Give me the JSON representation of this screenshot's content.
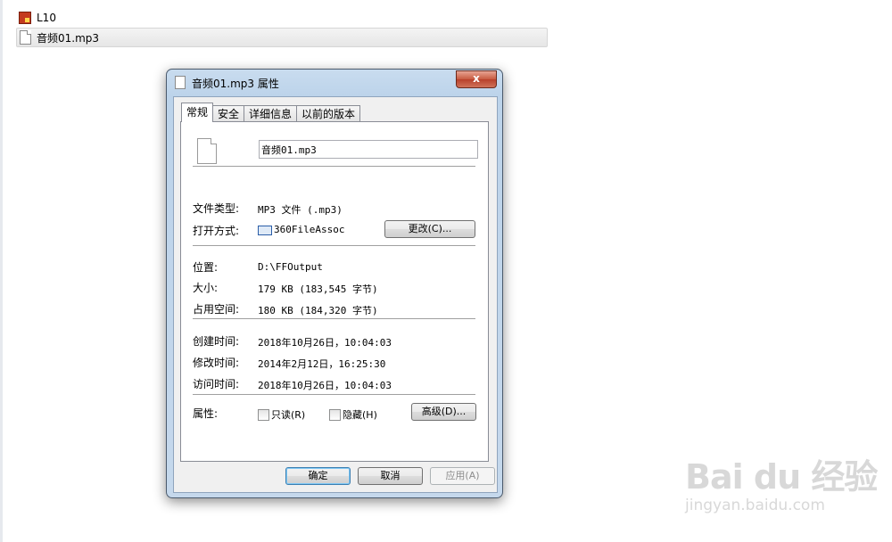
{
  "file_list": [
    {
      "name": "L10",
      "icon": "library-icon"
    },
    {
      "name": "音频01.mp3",
      "icon": "document-icon",
      "selected": true
    }
  ],
  "dialog": {
    "title": "音频01.mp3 属性",
    "close_label": "x",
    "tabs": [
      "常规",
      "安全",
      "详细信息",
      "以前的版本"
    ],
    "file_name": "音频01.mp3",
    "type_label": "文件类型:",
    "type_value": "MP3 文件 (.mp3)",
    "open_with_label": "打开方式:",
    "open_with_value": "360FileAssoc",
    "change_button": "更改(C)...",
    "location_label": "位置:",
    "location_value": "D:\\FFOutput",
    "size_label": "大小:",
    "size_value": "179 KB (183,545 字节)",
    "disk_size_label": "占用空间:",
    "disk_size_value": "180 KB (184,320 字节)",
    "created_label": "创建时间:",
    "created_value": "2018年10月26日，10:04:03",
    "modified_label": "修改时间:",
    "modified_value": "2014年2月12日，16:25:30",
    "accessed_label": "访问时间:",
    "accessed_value": "2018年10月26日，10:04:03",
    "attributes_label": "属性:",
    "readonly_label": "只读(R)",
    "hidden_label": "隐藏(H)",
    "advanced_button": "高级(D)...",
    "ok_button": "确定",
    "cancel_button": "取消",
    "apply_button": "应用(A)"
  },
  "watermark": {
    "logo": "Bai du 经验",
    "url": "jingyan.baidu.com"
  }
}
